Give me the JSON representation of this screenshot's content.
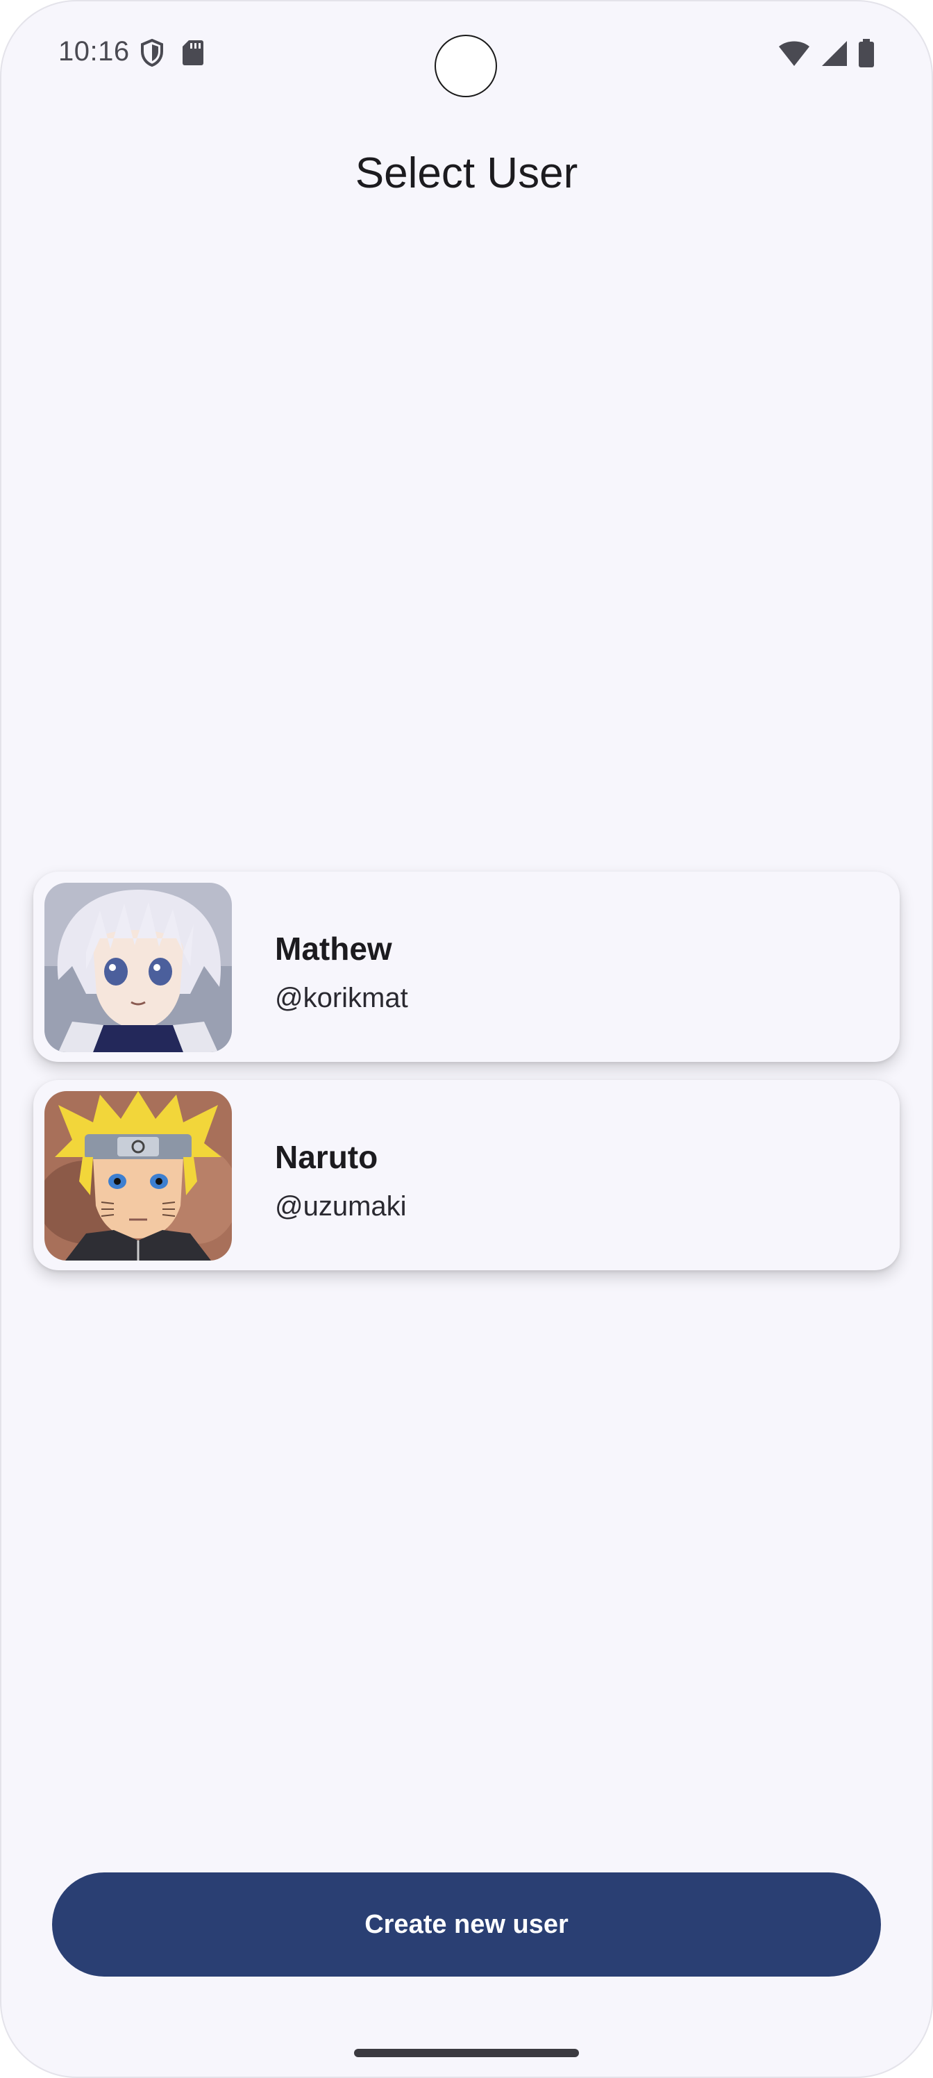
{
  "status_bar": {
    "time": "10:16",
    "left_icons": [
      "shield-icon",
      "sd-card-icon"
    ],
    "right_icons": [
      "wifi-icon",
      "signal-icon",
      "battery-icon"
    ]
  },
  "page": {
    "title": "Select User"
  },
  "users": [
    {
      "name": "Mathew",
      "handle": "@korikmat",
      "avatar": "anime-boy-white-hair-avatar"
    },
    {
      "name": "Naruto",
      "handle": "@uzumaki",
      "avatar": "anime-boy-blonde-headband-avatar"
    }
  ],
  "actions": {
    "create_label": "Create new user"
  },
  "colors": {
    "background": "#f7f6fc",
    "primary_button": "#2a3f73",
    "text": "#1c1b1f"
  }
}
